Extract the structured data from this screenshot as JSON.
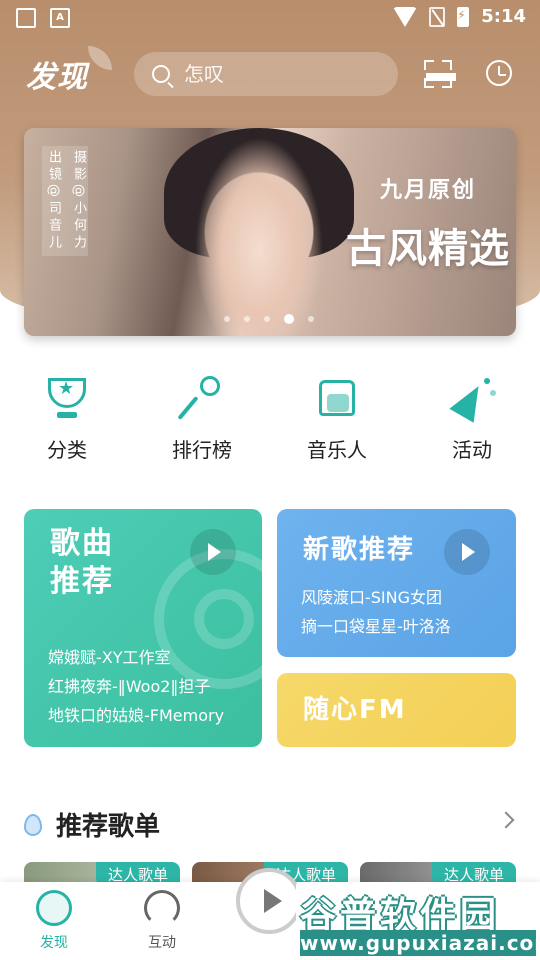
{
  "status_bar": {
    "time": "5:14",
    "left_icons": [
      "image-icon",
      "font-icon"
    ],
    "right_icons": [
      "wifi-icon",
      "no-sim-icon",
      "battery-charging-icon"
    ]
  },
  "header": {
    "brand": "发现",
    "search_placeholder": "怎叹",
    "icons": [
      "scan-icon",
      "history-clock-icon"
    ]
  },
  "banner": {
    "credit_photo": "摄影@小何力",
    "credit_makeup": "出镜@司音儿",
    "subtitle": "九月原创",
    "title": "古风精选",
    "page_count": 5,
    "active_page": 4
  },
  "quick_nav": [
    {
      "label": "分类",
      "icon": "trophy-icon"
    },
    {
      "label": "排行榜",
      "icon": "microphone-icon"
    },
    {
      "label": "音乐人",
      "icon": "shirt-icon"
    },
    {
      "label": "活动",
      "icon": "party-popper-icon"
    }
  ],
  "cards": {
    "song": {
      "title_line1": "歌曲",
      "title_line2": "推荐",
      "lines": [
        "嫦娥赋-XY工作室",
        "红拂夜奔-‖Woo2‖担子",
        "地铁口的姑娘-FMemory"
      ],
      "color": "#3fc4a8"
    },
    "new_songs": {
      "title": "新歌推荐",
      "lines": [
        "风陵渡口-SING女团",
        "摘一口袋星星-叶洛洛"
      ],
      "color": "#62a9ea"
    },
    "fm": {
      "title": "随心FM",
      "color": "#f4d45d"
    }
  },
  "playlists": {
    "title": "推荐歌单",
    "tag": "达人歌单"
  },
  "tabbar": {
    "tabs": [
      {
        "label": "发现",
        "icon": "discover-icon",
        "active": true
      },
      {
        "label": "互动",
        "icon": "headphones-icon",
        "active": false
      }
    ],
    "accent": "#26b3a6"
  },
  "watermark": {
    "title": "谷普软件园",
    "url": "www.gupuxiazai.com"
  }
}
